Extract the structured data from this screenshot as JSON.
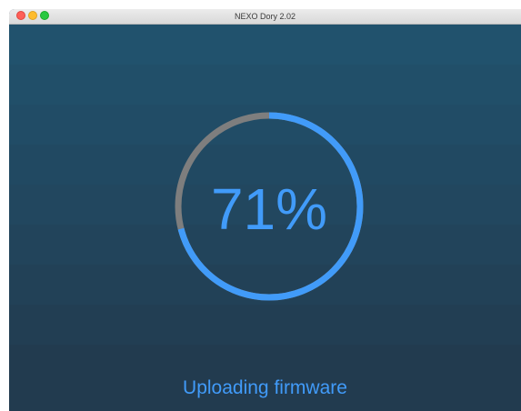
{
  "window": {
    "title": "NEXO Dory 2.02"
  },
  "progress": {
    "percent_label": "71%",
    "value": 0.71,
    "fill_color": "#419bf9",
    "track_color": "#7e7e7e",
    "status": "Uploading firmware"
  },
  "icons": {
    "close": "red-close-dot",
    "minimize": "yellow-minimize-dot",
    "maximize": "green-maximize-dot"
  }
}
